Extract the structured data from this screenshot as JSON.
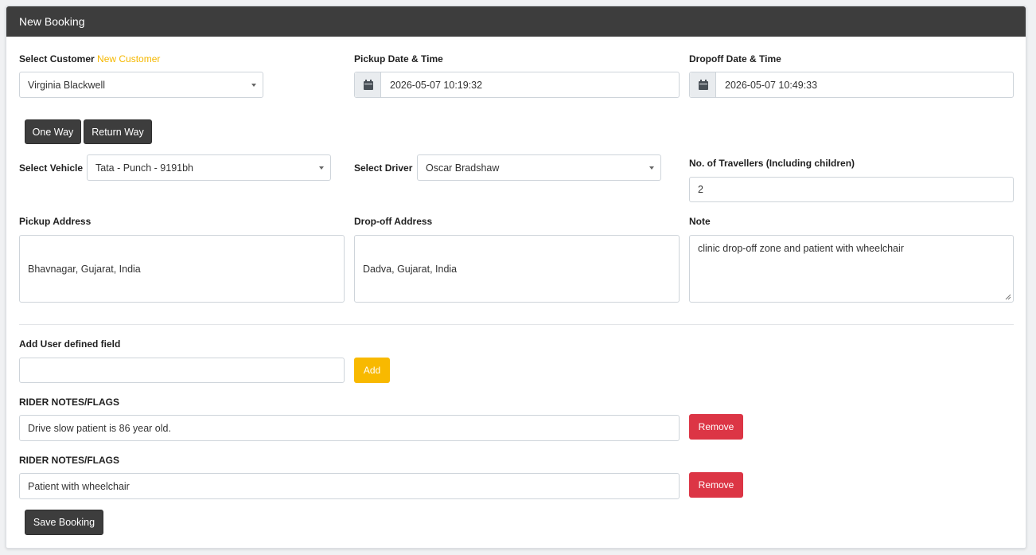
{
  "header": {
    "title": "New Booking"
  },
  "customer": {
    "label": "Select Customer",
    "new_link": "New Customer",
    "value": "Virginia Blackwell"
  },
  "pickup_datetime": {
    "label": "Pickup Date & Time",
    "value": "2026-05-07 10:19:32",
    "icon": "calendar-icon"
  },
  "dropoff_datetime": {
    "label": "Dropoff Date & Time",
    "value": "2026-05-07 10:49:33",
    "icon": "calendar-icon"
  },
  "trip_type": {
    "one_way": "One Way",
    "return_way": "Return Way"
  },
  "vehicle": {
    "label": "Select Vehicle",
    "value": "Tata - Punch - 9191bh"
  },
  "driver": {
    "label": "Select Driver",
    "value": "Oscar Bradshaw"
  },
  "travellers": {
    "label": "No. of Travellers (Including children)",
    "value": "2"
  },
  "pickup_address": {
    "label": "Pickup Address",
    "value": "Bhavnagar, Gujarat, India"
  },
  "dropoff_address": {
    "label": "Drop-off Address",
    "value": "Dadva, Gujarat, India"
  },
  "note": {
    "label": "Note",
    "value": "clinic drop-off zone and patient with wheelchair"
  },
  "user_field": {
    "label": "Add User defined field",
    "value": "",
    "add_label": "Add"
  },
  "rider_notes": [
    {
      "label": "RIDER NOTES/FLAGS",
      "value": "Drive slow patient is 86 year old.",
      "remove_label": "Remove"
    },
    {
      "label": "RIDER NOTES/FLAGS",
      "value": "Patient with wheelchair",
      "remove_label": "Remove"
    }
  ],
  "save_label": "Save Booking",
  "colors": {
    "header": "#3d3d3d",
    "accent": "#f8b900",
    "danger": "#dc3545"
  }
}
